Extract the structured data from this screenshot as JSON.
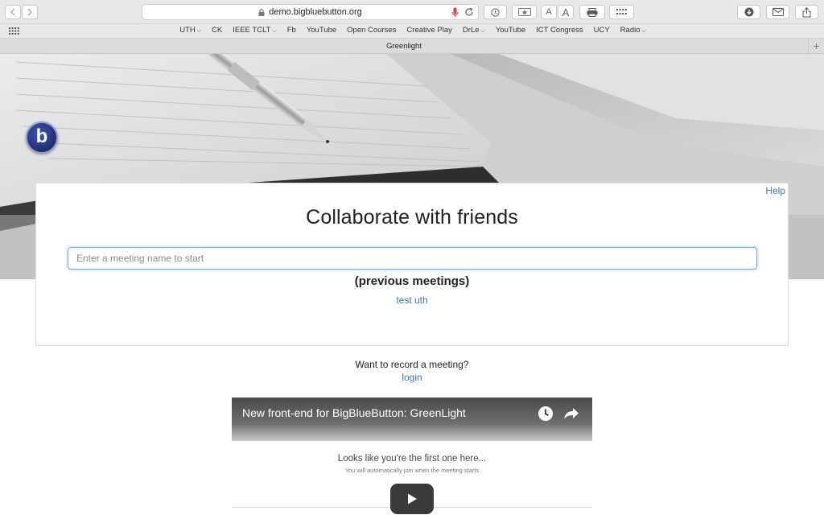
{
  "browser": {
    "address": "demo.bigbluebutton.org",
    "tab_title": "Greenlight",
    "font_small_label": "A",
    "font_large_label": "A",
    "new_tab_label": "+",
    "favorites": [
      {
        "label": "UTH",
        "menu": true
      },
      {
        "label": "CK",
        "menu": false
      },
      {
        "label": "IEEE TCLT",
        "menu": true
      },
      {
        "label": "Fb",
        "menu": false
      },
      {
        "label": "YouTube",
        "menu": false
      },
      {
        "label": "Open Courses",
        "menu": false
      },
      {
        "label": "Creative Play",
        "menu": false
      },
      {
        "label": "DrLe",
        "menu": true
      },
      {
        "label": "YouTube",
        "menu": false
      },
      {
        "label": "ICT Congress",
        "menu": false
      },
      {
        "label": "UCY",
        "menu": false
      },
      {
        "label": "Radio",
        "menu": true
      }
    ]
  },
  "logo": {
    "letter": "b",
    "brand_color": "#283593"
  },
  "card": {
    "help_label": "Help",
    "title": "Collaborate with friends",
    "input_placeholder": "Enter a meeting name to start",
    "input_value": "",
    "previous_heading": "(previous meetings)",
    "previous_meetings": [
      "test uth"
    ]
  },
  "record": {
    "question": "Want to record a meeting?",
    "login_label": "login"
  },
  "video": {
    "title": "New front-end for BigBlueButton: GreenLight",
    "line1": "Looks like you're the first one here...",
    "line2": "You will automatically join when the meeting starts",
    "icons": [
      "clock-icon",
      "share-icon",
      "play-icon"
    ]
  },
  "colors": {
    "link": "#337ab7",
    "focus": "#66afe9"
  }
}
